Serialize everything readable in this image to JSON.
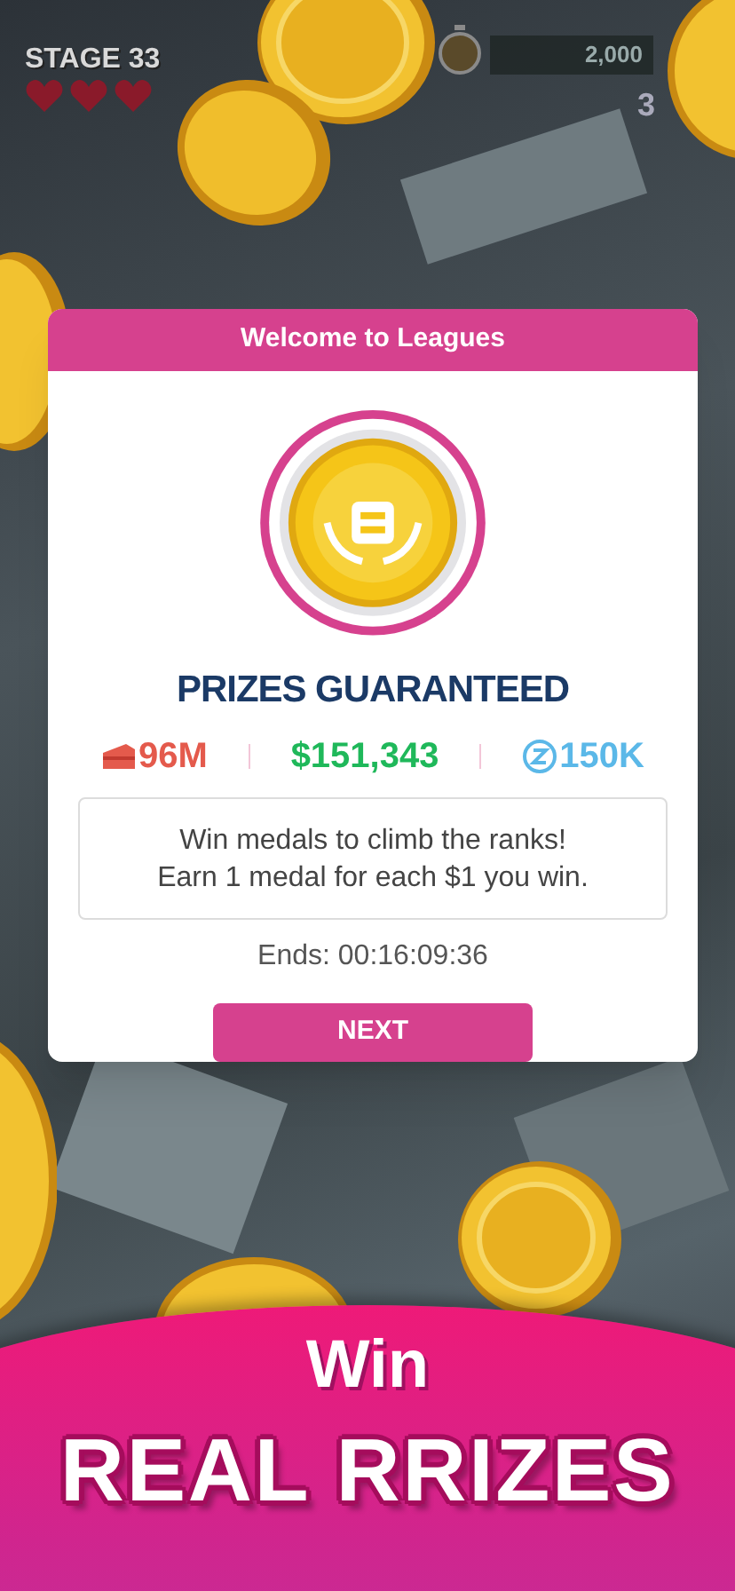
{
  "game_hud": {
    "stage": "STAGE 33",
    "hearts": [
      {
        "filled": true
      },
      {
        "filled": true
      },
      {
        "filled": true
      }
    ],
    "score": "2,000",
    "counter": "3"
  },
  "dialog": {
    "title": "Welcome to Leagues",
    "headline": "PRIZES GUARANTEED",
    "prizes": [
      {
        "kind": "tickets",
        "value": "96M"
      },
      {
        "kind": "cash",
        "value": "$151,343"
      },
      {
        "kind": "tokens",
        "value": "150K"
      }
    ],
    "message": [
      "Win medals to climb the ranks!",
      "Earn 1 medal for each $1 you win."
    ],
    "ends": "Ends: 00:16:09:36",
    "button": "NEXT"
  },
  "banner": {
    "line_1": "Win",
    "line_2": "REAL RRIZES"
  }
}
